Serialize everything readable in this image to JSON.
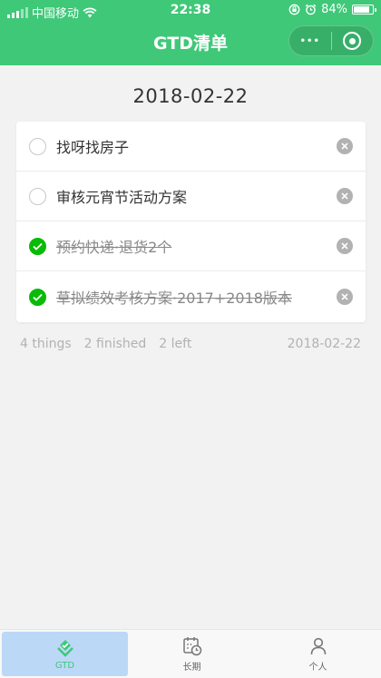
{
  "statusbar": {
    "carrier": "中国移动",
    "time": "22:38",
    "battery": "84%",
    "battery_level": 0.84
  },
  "navbar": {
    "title": "GTD清单",
    "more_icon": "•••"
  },
  "date": "2018-02-22",
  "tasks": [
    {
      "text": "找呀找房子",
      "done": false
    },
    {
      "text": "审核元宵节活动方案",
      "done": false
    },
    {
      "text": "预约快递·退货2个",
      "done": true
    },
    {
      "text": "草拟绩效考核方案·2017+2018版本",
      "done": true
    }
  ],
  "summary": {
    "things": "4 things",
    "finished": "2 finished",
    "left": "2 left",
    "date": "2018-02-22"
  },
  "tabbar": [
    {
      "label": "GTD",
      "icon": "gtd-icon",
      "active": true
    },
    {
      "label": "长期",
      "icon": "calendar-clock-icon",
      "active": false
    },
    {
      "label": "个人",
      "icon": "person-icon",
      "active": false
    }
  ],
  "colors": {
    "brand": "#3fc878",
    "check_done": "#09bb07",
    "active_tab": "#bcd8f7"
  }
}
